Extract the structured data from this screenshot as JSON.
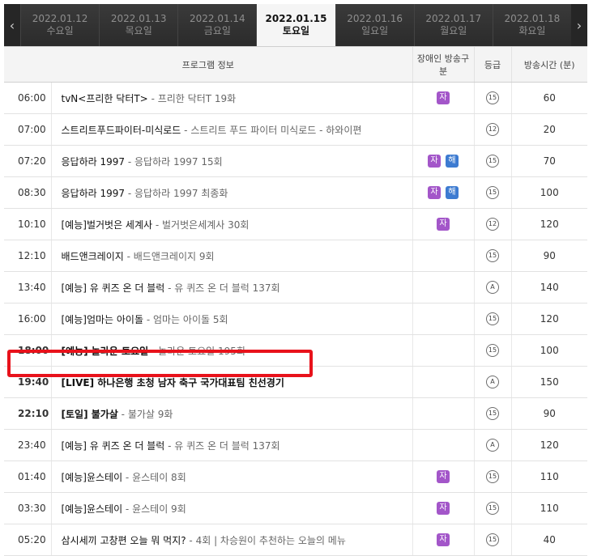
{
  "nav": {
    "prev_icon": "‹",
    "next_icon": "›"
  },
  "dates": [
    {
      "date": "2022.01.12",
      "day": "수요일",
      "active": false
    },
    {
      "date": "2022.01.13",
      "day": "목요일",
      "active": false
    },
    {
      "date": "2022.01.14",
      "day": "금요일",
      "active": false
    },
    {
      "date": "2022.01.15",
      "day": "토요일",
      "active": true
    },
    {
      "date": "2022.01.16",
      "day": "일요일",
      "active": false
    },
    {
      "date": "2022.01.17",
      "day": "월요일",
      "active": false
    },
    {
      "date": "2022.01.18",
      "day": "화요일",
      "active": false
    }
  ],
  "headers": {
    "program": "프로그램 정보",
    "access": "장애인 방송구분",
    "grade": "등급",
    "duration": "방송시간 (분)"
  },
  "rows": [
    {
      "time": "06:00",
      "title": "tvN<프리한 닥터T>",
      "episode": "프리한 닥터T 19화",
      "badges": [
        "자"
      ],
      "grade": "15",
      "duration": "60",
      "bold": false
    },
    {
      "time": "07:00",
      "title": "스트리트푸드파이터-미식로드",
      "episode": "스트리트 푸드 파이터 미식로드 - 하와이편",
      "badges": [],
      "grade": "12",
      "duration": "20",
      "bold": false
    },
    {
      "time": "07:20",
      "title": "응답하라 1997",
      "episode": "응답하라 1997 15회",
      "badges": [
        "자",
        "해"
      ],
      "grade": "15",
      "duration": "70",
      "bold": false
    },
    {
      "time": "08:30",
      "title": "응답하라 1997",
      "episode": "응답하라 1997 최종화",
      "badges": [
        "자",
        "해"
      ],
      "grade": "15",
      "duration": "100",
      "bold": false
    },
    {
      "time": "10:10",
      "title": "[예능]벌거벗은 세계사",
      "episode": "벌거벗은세계사 30회",
      "badges": [
        "자"
      ],
      "grade": "12",
      "duration": "120",
      "bold": false
    },
    {
      "time": "12:10",
      "title": "배드앤크레이지",
      "episode": "배드앤크레이지 9회",
      "badges": [],
      "grade": "15",
      "duration": "90",
      "bold": false
    },
    {
      "time": "13:40",
      "title": "[예능] 유 퀴즈 온 더 블럭",
      "episode": "유 퀴즈 온 더 블럭 137회",
      "badges": [],
      "grade": "A",
      "duration": "140",
      "bold": false
    },
    {
      "time": "16:00",
      "title": "[예능]엄마는 아이돌",
      "episode": "엄마는 아이돌 5회",
      "badges": [],
      "grade": "15",
      "duration": "120",
      "bold": false
    },
    {
      "time": "18:00",
      "title": "[예능] 놀라운 토요일",
      "episode": "놀라운 토요일 195회",
      "badges": [],
      "grade": "15",
      "duration": "100",
      "bold": true
    },
    {
      "time": "19:40",
      "title": "[LIVE] 하나은행 초청 남자 축구 국가대표팀 친선경기",
      "episode": "",
      "badges": [],
      "grade": "A",
      "duration": "150",
      "bold": true
    },
    {
      "time": "22:10",
      "title": "[토일] 불가살",
      "episode": "불가살 9화",
      "badges": [],
      "grade": "15",
      "duration": "90",
      "bold": true
    },
    {
      "time": "23:40",
      "title": "[예능] 유 퀴즈 온 더 블럭",
      "episode": "유 퀴즈 온 더 블럭 137회",
      "badges": [],
      "grade": "A",
      "duration": "120",
      "bold": false
    },
    {
      "time": "01:40",
      "title": "[예능]윤스테이",
      "episode": "윤스테이 8회",
      "badges": [
        "자"
      ],
      "grade": "15",
      "duration": "110",
      "bold": false
    },
    {
      "time": "03:30",
      "title": "[예능]윤스테이",
      "episode": "윤스테이 9회",
      "badges": [
        "자"
      ],
      "grade": "15",
      "duration": "110",
      "bold": false
    },
    {
      "time": "05:20",
      "title": "삼시세끼 고창편 오늘 뭐 먹지?",
      "episode": "4회 | 차승원이 추천하는 오늘의 메뉴",
      "badges": [
        "자"
      ],
      "grade": "15",
      "duration": "40",
      "bold": false
    }
  ],
  "colors": {
    "badge_ja": "#a356c9",
    "badge_hae": "#3d7bd1",
    "highlight": "#e8121b"
  }
}
